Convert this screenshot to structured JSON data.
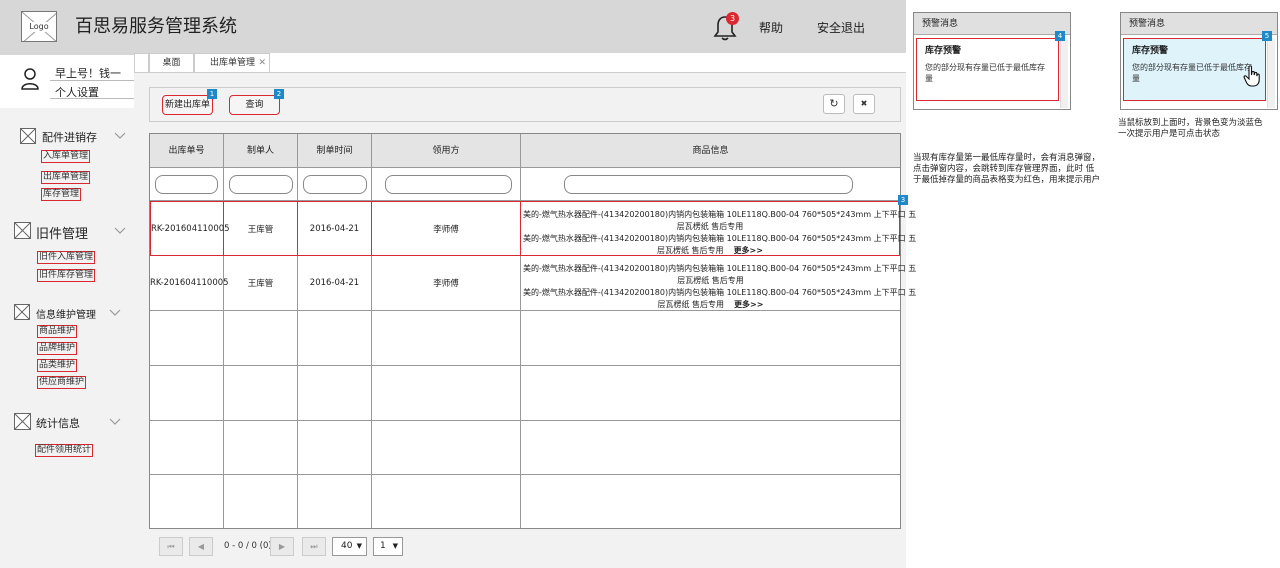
{
  "header": {
    "logo": "Logo",
    "title": "百思易服务管理系统",
    "notification_count": "3",
    "help": "帮助",
    "logout": "安全退出"
  },
  "user": {
    "greeting": "早上号！钱一",
    "settings": "个人设置"
  },
  "sidebar": {
    "groups": [
      {
        "title": "配件进销存",
        "items": [
          "入库单管理",
          "出库单管理",
          "库存管理"
        ]
      },
      {
        "title": "旧件管理",
        "items": [
          "旧件入库管理",
          "旧件库存管理"
        ]
      },
      {
        "title": "信息维护管理",
        "items": [
          "商品维护",
          "品牌维护",
          "品类维护",
          "供应商维护"
        ]
      },
      {
        "title": "统计信息",
        "items": [
          "配件领用统计"
        ]
      }
    ]
  },
  "tabs": [
    {
      "label": "桌面"
    },
    {
      "label": "出库单管理",
      "close": "✕"
    }
  ],
  "toolbar": {
    "new_label": "新建出库单",
    "new_badge": "1",
    "query_label": "查询",
    "query_badge": "2",
    "refresh_icon": "↻",
    "close_icon": "✖"
  },
  "table": {
    "columns": [
      "出库单号",
      "制单人",
      "制单时间",
      "领用方",
      "商品信息"
    ],
    "row_badge": "3",
    "rows": [
      {
        "order_no": "RK-201604110005",
        "creator": "王库管",
        "date": "2016-04-21",
        "receiver": "李师傅",
        "info_1": "美的-燃气热水器配件-(413420200180)内销内包装箱箱 10LE118Q.B00-04 760*505*243mm 上下平口 五",
        "info_2": "层瓦楞纸 售后专用",
        "info_3": "美的-燃气热水器配件-(413420200180)内销内包装箱箱 10LE118Q.B00-04 760*505*243mm 上下平口 五",
        "info_4": "层瓦楞纸 售后专用",
        "more": "更多>>"
      },
      {
        "order_no": "RK-201604110005",
        "creator": "王库管",
        "date": "2016-04-21",
        "receiver": "李师傅",
        "info_1": "美的-燃气热水器配件-(413420200180)内销内包装箱箱 10LE118Q.B00-04 760*505*243mm 上下平口 五",
        "info_2": "层瓦楞纸 售后专用",
        "info_3": "美的-燃气热水器配件-(413420200180)内销内包装箱箱 10LE118Q.B00-04 760*505*243mm 上下平口 五",
        "info_4": "层瓦楞纸 售后专用",
        "more": "更多>>"
      }
    ]
  },
  "pager": {
    "first": "⏮",
    "prev": "◀",
    "status": "0 - 0 / 0 (0)",
    "next": "▶",
    "last": "⏭",
    "page_size": "40",
    "page": "1",
    "caret": "▼"
  },
  "annotations": {
    "popup_normal": {
      "header": "预警消息",
      "title": "库存预警",
      "message": "您的部分现有存量已低于最低库存量",
      "badge": "4"
    },
    "popup_hover": {
      "header": "预警消息",
      "title": "库存预警",
      "message": "您的部分现有存量已低于最低库存量",
      "badge": "5"
    },
    "hover_note_1": "当鼠标放到上面时，背景色变为淡蓝色",
    "hover_note_2": "一次提示用户是可点击状态",
    "alert_note_1": "当现有库存量第一最低库存量时，会有消息弹窗，",
    "alert_note_2": "点击弹窗内容，会跳转到库存管理界面，此时 低",
    "alert_note_3": "于最低掉存量的商品表格变为红色，用来提示用户"
  },
  "colors": {
    "header_bg": "#d7d7d7",
    "alert_red": "#d9282f",
    "badge_blue": "#1e88c9",
    "hover_bg": "#dff3fb"
  }
}
